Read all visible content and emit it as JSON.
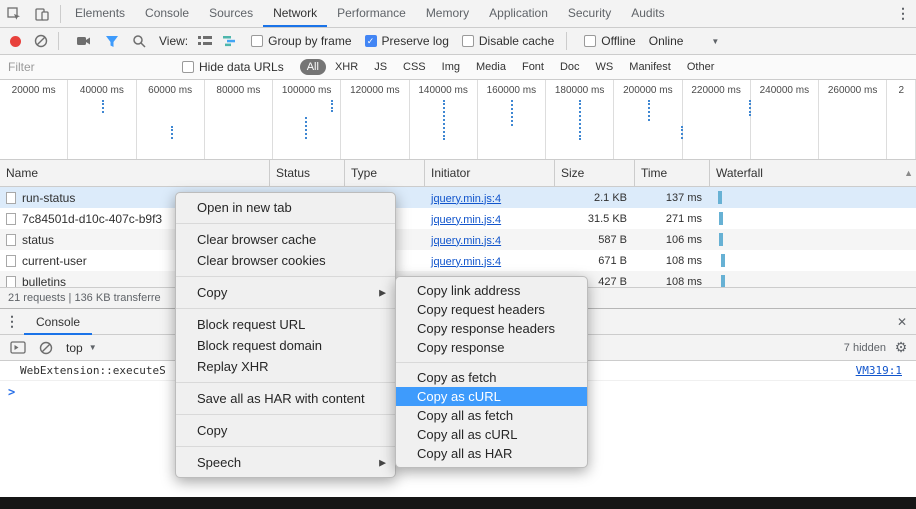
{
  "icons": {
    "check": "✓",
    "kebab": "⋮",
    "close": "✕",
    "submenu_arrow": "▶",
    "scroll_up": "▲",
    "dropdown_arrow": "▼",
    "gear": "⚙",
    "prompt_chevron": ">"
  },
  "main_tabs": {
    "active_tab": "Network",
    "items": [
      {
        "label": "Elements"
      },
      {
        "label": "Console"
      },
      {
        "label": "Sources"
      },
      {
        "label": "Network"
      },
      {
        "label": "Performance"
      },
      {
        "label": "Memory"
      },
      {
        "label": "Application"
      },
      {
        "label": "Security"
      },
      {
        "label": "Audits"
      }
    ]
  },
  "network_toolbar": {
    "view_label": "View:",
    "group_by_frame": "Group by frame",
    "preserve_log": "Preserve log",
    "disable_cache": "Disable cache",
    "offline": "Offline",
    "throttling_value": "Online",
    "checkbox_states": {
      "group_by_frame": false,
      "preserve_log": true,
      "disable_cache": false,
      "offline": false
    }
  },
  "filter_bar": {
    "filter_placeholder": "Filter",
    "hide_data_urls": "Hide data URLs",
    "hide_data_urls_checked": false,
    "active_pill": "All",
    "pills": [
      "All",
      "XHR",
      "JS",
      "CSS",
      "Img",
      "Media",
      "Font",
      "Doc",
      "WS",
      "Manifest",
      "Other"
    ]
  },
  "timeline": {
    "labels": [
      "20000 ms",
      "40000 ms",
      "60000 ms",
      "80000 ms",
      "100000 ms",
      "120000 ms",
      "140000 ms",
      "160000 ms",
      "180000 ms",
      "200000 ms",
      "220000 ms",
      "240000 ms",
      "260000 ms",
      "2"
    ]
  },
  "requests_table": {
    "columns": [
      "Name",
      "Status",
      "Type",
      "Initiator",
      "Size",
      "Time",
      "Waterfall"
    ],
    "rows": [
      {
        "name": "run-status",
        "initiator": "jquery.min.js:4",
        "size": "2.1 KB",
        "time": "137 ms"
      },
      {
        "name": "7c84501d-d10c-407c-b9f3",
        "initiator": "jquery.min.js:4",
        "size": "31.5 KB",
        "time": "271 ms"
      },
      {
        "name": "status",
        "initiator": "jquery.min.js:4",
        "size": "587 B",
        "time": "106 ms"
      },
      {
        "name": "current-user",
        "initiator": "jquery.min.js:4",
        "size": "671 B",
        "time": "108 ms"
      },
      {
        "name": "bulletins",
        "initiator": "",
        "size": "427 B",
        "time": "108 ms"
      }
    ],
    "summary": "21 requests | 136 KB transferre"
  },
  "context_menu": {
    "open_in_new_tab": "Open in new tab",
    "clear_browser_cache": "Clear browser cache",
    "clear_browser_cookies": "Clear browser cookies",
    "copy_submenu": "Copy",
    "block_request_url": "Block request URL",
    "block_request_domain": "Block request domain",
    "replay_xhr": "Replay XHR",
    "save_har": "Save all as HAR with content",
    "copy": "Copy",
    "speech": "Speech"
  },
  "copy_submenu": {
    "highlighted": "Copy as cURL",
    "items": [
      "Copy link address",
      "Copy request headers",
      "Copy response headers",
      "Copy response",
      "Copy as fetch",
      "Copy as cURL",
      "Copy all as fetch",
      "Copy all as cURL",
      "Copy all as HAR"
    ]
  },
  "console_drawer": {
    "tab_label": "Console",
    "context_selector": "top",
    "hidden_count": "7 hidden",
    "message": "WebExtension::executeS",
    "message_source": "VM319:1"
  }
}
